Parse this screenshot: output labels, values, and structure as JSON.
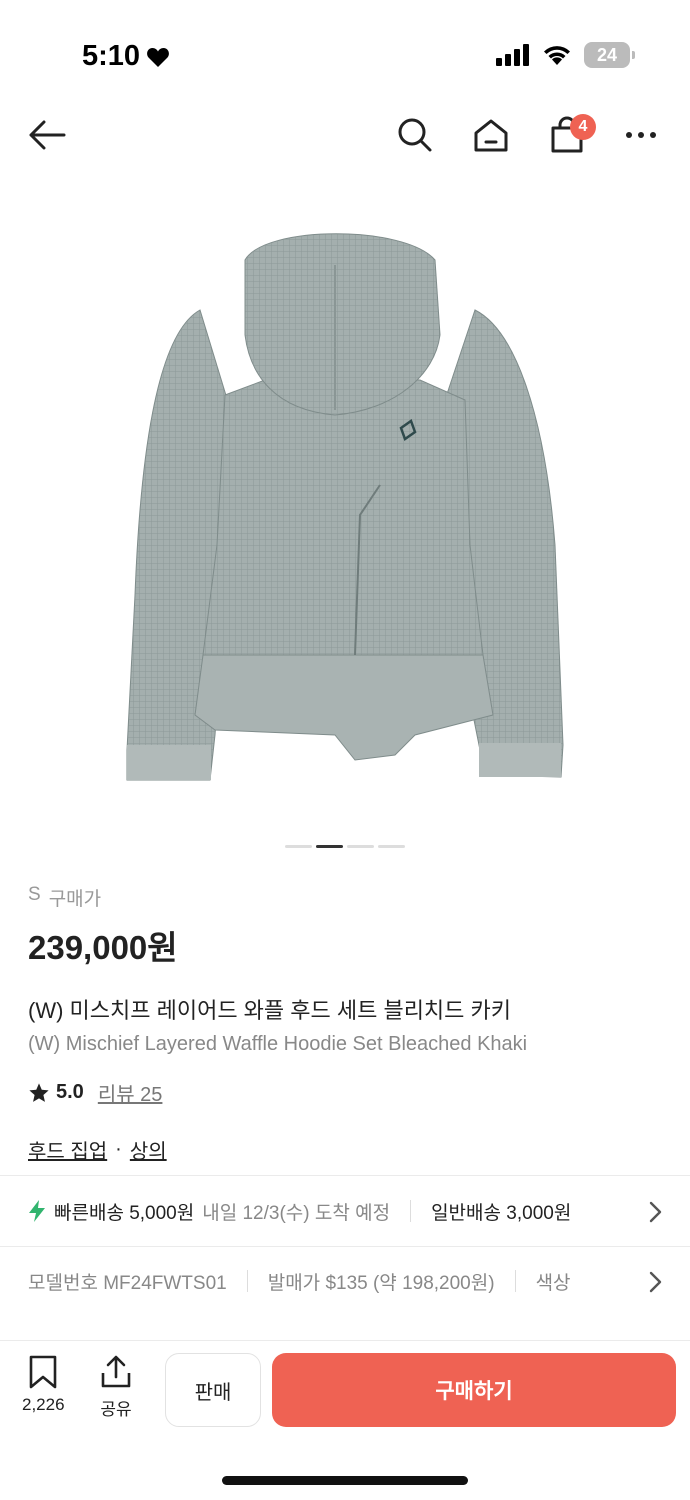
{
  "status_bar": {
    "time": "5:10",
    "battery": "24"
  },
  "nav": {
    "cart_count": "4"
  },
  "gallery": {
    "current_index": 2,
    "total": 4
  },
  "product": {
    "size_prefix": "S",
    "size_label": "구매가",
    "price": "239,000원",
    "title_ko": "(W) 미스치프 레이어드 와플 후드 세트 블리치드 카키",
    "title_en": "(W) Mischief Layered Waffle Hoodie Set Bleached Khaki",
    "rating": "5.0",
    "review_label": "리뷰 25",
    "category_1": "후드 집업",
    "category_sep": "·",
    "category_2": "상의"
  },
  "shipping": {
    "fast_label": "빠른배송 5,000원",
    "eta": "내일 12/3(수) 도착 예정",
    "normal_label": "일반배송 3,000원"
  },
  "specs": {
    "model": "모델번호 MF24FWTS01",
    "release_price": "발매가 $135 (약 198,200원)",
    "color": "색상"
  },
  "bottom": {
    "wish_count": "2,226",
    "share_label": "공유",
    "sell_label": "판매",
    "buy_label": "구매하기"
  },
  "colors": {
    "accent": "#ef6253",
    "fast_ship": "#31b46e"
  }
}
